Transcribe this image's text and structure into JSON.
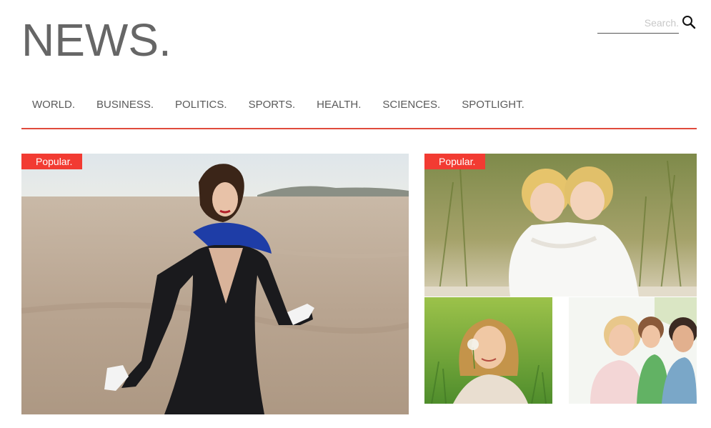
{
  "header": {
    "site_title": "NEWS.",
    "search_placeholder": "Search."
  },
  "nav": {
    "items": [
      "WORLD.",
      "BUSINESS.",
      "POLITICS.",
      "SPORTS.",
      "HEALTH.",
      "SCIENCES.",
      "SPOTLIGHT."
    ],
    "underline_color": "#e04a3c"
  },
  "featured": {
    "main_badge": "Popular.",
    "side_badge": "Popular."
  },
  "colors": {
    "accent": "#f23b32",
    "title": "#666666",
    "nav_text": "#5a5a5a"
  }
}
